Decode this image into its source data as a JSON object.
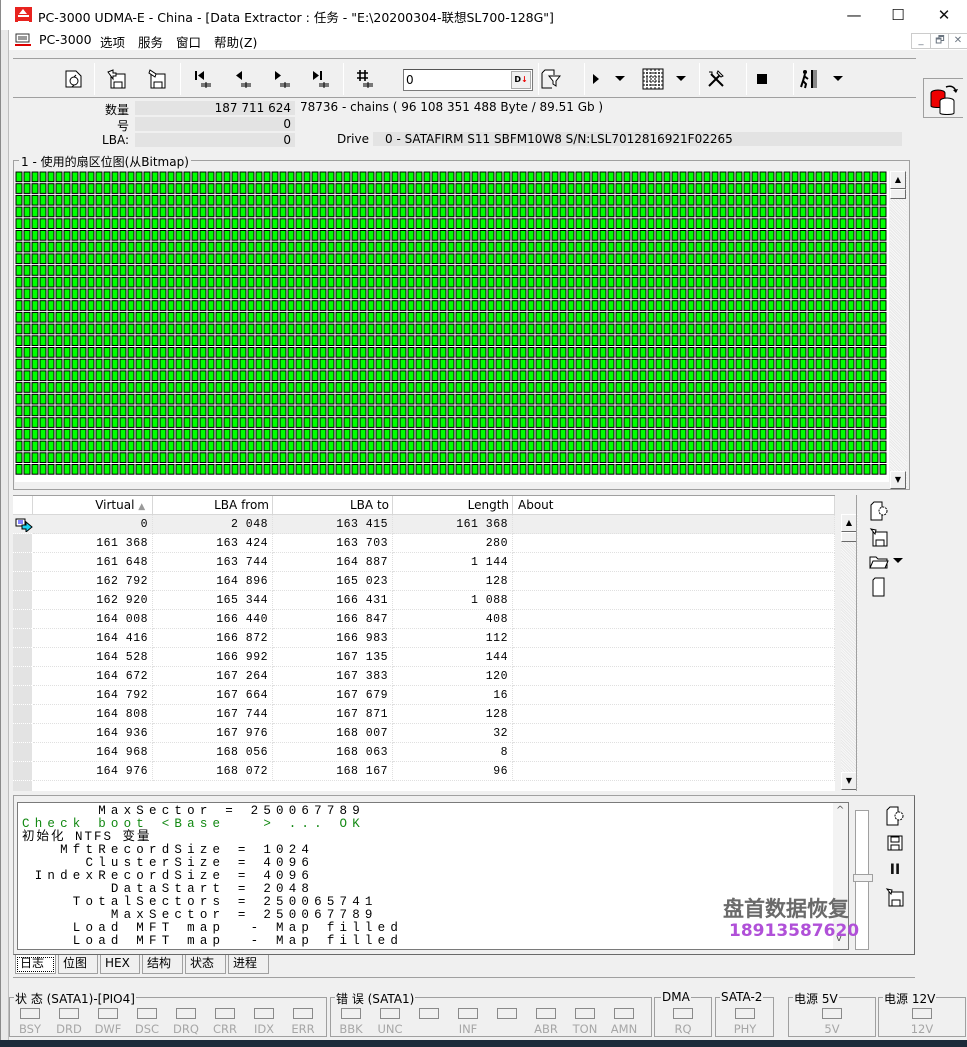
{
  "window": {
    "title": "PC-3000 UDMA-E - China - [Data Extractor : 任务 - \"E:\\20200304-联想SL700-128G\"]",
    "minimize": "—",
    "maximize": "☐",
    "close": "✕"
  },
  "menu": {
    "items": [
      "PC-3000",
      "选项",
      "服务",
      "窗口",
      "帮助(Z)"
    ],
    "mdi_buttons": [
      "_",
      "🗗",
      "✕"
    ]
  },
  "toolbar": {
    "lba_input_value": "0",
    "lba_button": "D",
    "icons": [
      "refresh-disk-icon",
      "save-load-icon",
      "save-export-icon",
      "first-icon",
      "prev-icon",
      "next-icon",
      "last-icon",
      "goto-number-icon",
      "filter-icon",
      "play-icon",
      "play-dropdown-icon",
      "grid-icon",
      "grid-dropdown-icon",
      "tools-icon",
      "stop-icon",
      "exit-icon",
      "exit-dropdown-icon"
    ]
  },
  "info": {
    "count_label": "数量",
    "count_value": "187 711 624",
    "count_extra": "78736 - chains  ( 96 108 351 488 Byte /  89.51 Gb )",
    "number_label": "号",
    "number_value": "0",
    "lba_label": "LBA:",
    "lba_value": "0",
    "drive_label": "Drive",
    "drive_value": "0 - SATAFIRM   S11 SBFM10W8 S/N:LSL7012816921F02265"
  },
  "bitmap": {
    "title": "1 - 使用的扇区位图(从Bitmap)",
    "fill_color": "#00ff00",
    "used_fraction": 1.0
  },
  "table": {
    "columns": [
      "Virtual",
      "LBA from",
      "LBA to",
      "Length",
      "About"
    ],
    "sort_indicator": "▲",
    "rows": [
      [
        "0",
        "2 048",
        "163 415",
        "161 368",
        ""
      ],
      [
        "161 368",
        "163 424",
        "163 703",
        "280",
        ""
      ],
      [
        "161 648",
        "163 744",
        "164 887",
        "1 144",
        ""
      ],
      [
        "162 792",
        "164 896",
        "165 023",
        "128",
        ""
      ],
      [
        "162 920",
        "165 344",
        "166 431",
        "1 088",
        ""
      ],
      [
        "164 008",
        "166 440",
        "166 847",
        "408",
        ""
      ],
      [
        "164 416",
        "166 872",
        "166 983",
        "112",
        ""
      ],
      [
        "164 528",
        "166 992",
        "167 135",
        "144",
        ""
      ],
      [
        "164 672",
        "167 264",
        "167 383",
        "120",
        ""
      ],
      [
        "164 792",
        "167 664",
        "167 679",
        "16",
        ""
      ],
      [
        "164 808",
        "167 744",
        "167 871",
        "128",
        ""
      ],
      [
        "164 936",
        "167 976",
        "168 007",
        "32",
        ""
      ],
      [
        "164 968",
        "168 056",
        "168 063",
        "8",
        ""
      ],
      [
        "164 976",
        "168 072",
        "168 167",
        "96",
        ""
      ]
    ]
  },
  "log": {
    "lines": [
      {
        "text": "      MaxSector = 250067789",
        "color": "black"
      },
      {
        "text": "Check boot <Base   > ... OK",
        "color": "green"
      },
      {
        "text": "初始化 NTFS 变量",
        "color": "black"
      },
      {
        "text": "   MftRecordSize = 1024",
        "color": "black"
      },
      {
        "text": "     ClusterSize = 4096",
        "color": "black"
      },
      {
        "text": " IndexRecordSize = 4096",
        "color": "black"
      },
      {
        "text": "       DataStart = 2048",
        "color": "black"
      },
      {
        "text": "    TotalSectors = 250065741",
        "color": "black"
      },
      {
        "text": "       MaxSector = 250067789",
        "color": "black"
      },
      {
        "text": "    Load MFT map  - Map filled",
        "color": "black"
      },
      {
        "text": "    Load MFT map  - Map filled",
        "color": "black"
      }
    ],
    "pause_label": "II"
  },
  "tabs": [
    "日志",
    "位图",
    "HEX",
    "结构",
    "状态",
    "进程"
  ],
  "active_tab": "日志",
  "status": {
    "state_title": "状 态 (SATA1)-[PIO4]",
    "state_leds": [
      "BSY",
      "DRD",
      "DWF",
      "DSC",
      "DRQ",
      "CRR",
      "IDX",
      "ERR"
    ],
    "error_title": "错 误 (SATA1)",
    "error_leds": [
      "BBK",
      "UNC",
      "",
      "INF",
      "",
      "ABR",
      "TON",
      "AMN"
    ],
    "dma_title": "DMA",
    "dma_led": "RQ",
    "sata_title": "SATA-2",
    "sata_led": "PHY",
    "p5_title": "电源 5V",
    "p5_led": "5V",
    "p12_title": "电源 12V",
    "p12_led": "12V"
  },
  "watermark": {
    "name": "盘首数据恢复",
    "phone": "18913587620"
  }
}
